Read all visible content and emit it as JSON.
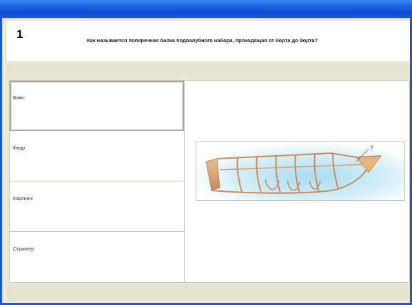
{
  "question": {
    "number": "1",
    "text": "Как называется поперечная балка подпалубного набора, проходящая от борта до борта?"
  },
  "answers": [
    {
      "label": "Бимс",
      "selected": true
    },
    {
      "label": "Флор",
      "selected": false
    },
    {
      "label": "Карлингс",
      "selected": false
    },
    {
      "label": "Стрингер",
      "selected": false
    }
  ],
  "illustration": {
    "callout": "?"
  },
  "colors": {
    "titlebar": "#1a62e0",
    "band": "#e6e3cf",
    "wood": "#d8a46c"
  }
}
